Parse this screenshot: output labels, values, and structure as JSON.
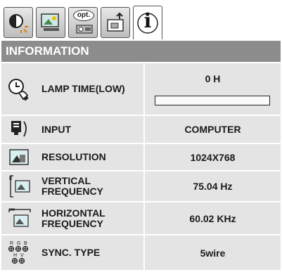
{
  "tabs": [
    {
      "name": "picture-adjust-tab",
      "icon": "contrast-brightness-icon"
    },
    {
      "name": "image-position-tab",
      "icon": "image-screen-icon"
    },
    {
      "name": "options-tab",
      "icon": "opt-icon",
      "label": "opt."
    },
    {
      "name": "setting-tab",
      "icon": "install-icon"
    },
    {
      "name": "information-tab",
      "icon": "info-icon",
      "label": "i",
      "active": true
    }
  ],
  "header": {
    "title": "INFORMATION"
  },
  "rows": {
    "lamp": {
      "label": "LAMP TIME(LOW)",
      "value": "0 H",
      "progress": 0
    },
    "input": {
      "label": "INPUT",
      "value": "COMPUTER"
    },
    "resolution": {
      "label": "RESOLUTION",
      "value": "1024X768"
    },
    "vertical": {
      "label_line1": "VERTICAL",
      "label_line2": "FREQUENCY",
      "value": "75.04 Hz"
    },
    "horizontal": {
      "label_line1": "HORIZONTAL",
      "label_line2": "FREQUENCY",
      "value": "60.02 KHz"
    },
    "sync": {
      "label": "SYNC. TYPE",
      "value": "5wire",
      "icon_letters": [
        "R",
        "G",
        "B",
        "H",
        "V"
      ]
    }
  },
  "colors": {
    "header_bg": "#8c8c8c",
    "row_bg": "#e4e4e4",
    "text": "#1a1a1a"
  }
}
